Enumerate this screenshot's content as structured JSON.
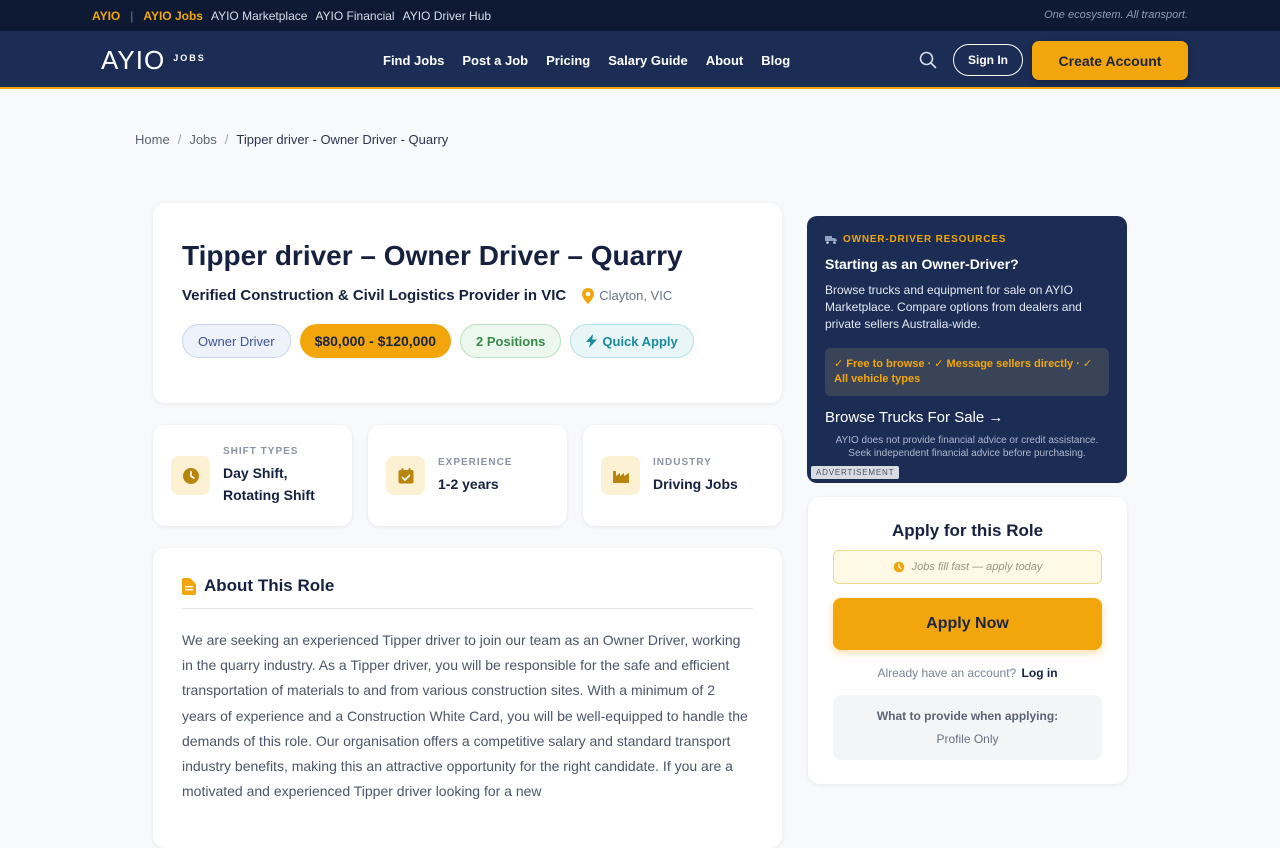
{
  "ecobar": {
    "brand": "AYIO",
    "sep": "|",
    "links": [
      "AYIO Jobs",
      "AYIO Marketplace",
      "AYIO Financial",
      "AYIO Driver Hub"
    ],
    "tagline": "One ecosystem. All transport."
  },
  "header": {
    "logo": "AYIO",
    "logo_sub": "JOBS",
    "nav": [
      "Find Jobs",
      "Post a Job",
      "Pricing",
      "Salary Guide",
      "About",
      "Blog"
    ],
    "sign_in": "Sign In",
    "create_account": "Create Account"
  },
  "breadcrumb": {
    "items": [
      "Home",
      "Jobs"
    ],
    "sep": "/",
    "current": "Tipper driver - Owner Driver - Quarry"
  },
  "job": {
    "title": "Tipper driver – Owner Driver – Quarry",
    "company": "Verified Construction & Civil Logistics Provider in VIC",
    "location": "Clayton, VIC",
    "chips": {
      "type": "Owner Driver",
      "salary": "$80,000 - $120,000",
      "positions": "2 Positions",
      "quick": "Quick Apply"
    }
  },
  "info": {
    "shift": {
      "label": "SHIFT TYPES",
      "value_line1": "Day Shift,",
      "value_line2": "Rotating Shift"
    },
    "experience": {
      "label": "EXPERIENCE",
      "value": "1-2 years"
    },
    "industry": {
      "label": "INDUSTRY",
      "value": "Driving Jobs"
    }
  },
  "about": {
    "heading": "About This Role",
    "body": "We are seeking an experienced Tipper driver to join our team as an Owner Driver, working in the quarry industry. As a Tipper driver, you will be responsible for the safe and efficient transportation of materials to and from various construction sites. With a minimum of 2 years of experience and a Construction White Card, you will be well-equipped to handle the demands of this role. Our organisation offers a competitive salary and standard transport industry benefits, making this an attractive opportunity for the right candidate. If you are a motivated and experienced Tipper driver looking for a new"
  },
  "ad": {
    "kicker": "OWNER-DRIVER RESOURCES",
    "title": "Starting as an Owner-Driver?",
    "body": "Browse trucks and equipment for sale on AYIO Marketplace. Compare options from dealers and private sellers Australia-wide.",
    "perks": "✓ Free to browse · ✓ Message sellers directly · ✓ All vehicle types",
    "cta": "Browse Trucks For Sale →",
    "disclaimer": "AYIO does not provide financial advice or credit assistance. Seek independent financial advice before purchasing.",
    "label": "ADVERTISEMENT"
  },
  "apply": {
    "title": "Apply for this Role",
    "urgency": "Jobs fill fast — apply today",
    "button": "Apply Now",
    "login_prompt": "Already have an account?",
    "login_link": "Log in",
    "provide_title": "What to provide when applying:",
    "provide_value": "Profile Only"
  },
  "colors": {
    "accent": "#f3a60b",
    "navy": "#1b2d55",
    "dark_navy": "#0e1a33"
  }
}
